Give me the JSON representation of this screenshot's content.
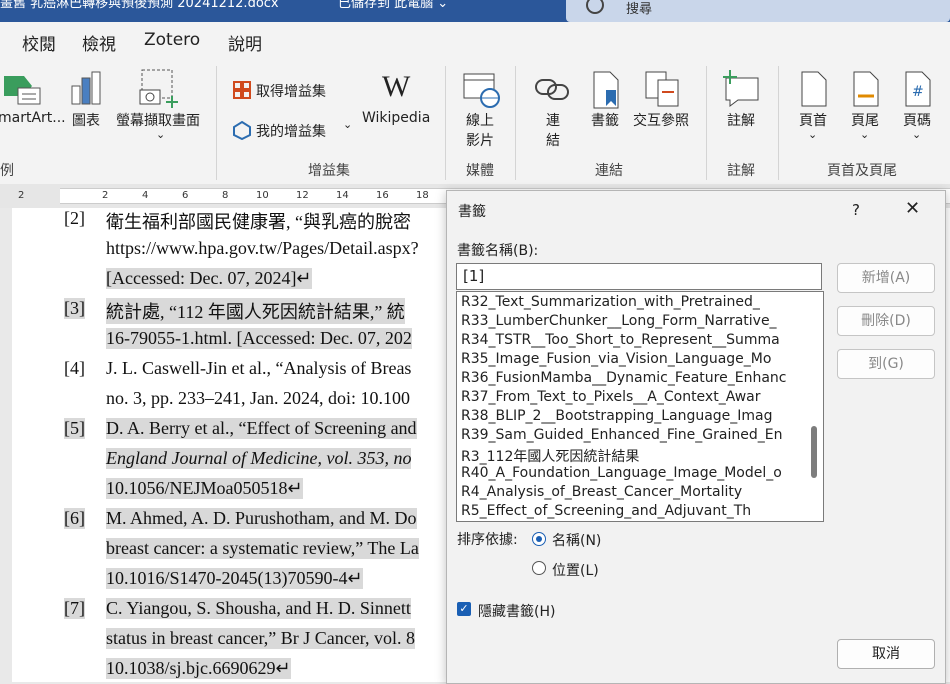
{
  "titlebar": {
    "document_name": "畫舊 乳癌淋巴轉移與預後預測 20241212.docx",
    "save_status": "已儲存到 此電腦 ⌄",
    "search_placeholder": "搜尋"
  },
  "ribbon_tabs": [
    "校閱",
    "檢視",
    "Zotero",
    "說明"
  ],
  "ribbon": {
    "smartart": "martArt...",
    "chart": "圖表",
    "screenshot": "螢幕擷取畫面",
    "get_addins": "取得增益集",
    "my_addins": "我的增益集",
    "wikipedia": "Wikipedia",
    "online_video_line1": "線上",
    "online_video_line2": "影片",
    "link_line1": "連",
    "link_line2": "結",
    "bookmark": "書籤",
    "cross_reference": "交互參照",
    "comment": "註解",
    "header": "頁首",
    "footer": "頁尾",
    "page_number": "頁碼",
    "groups": {
      "illustrations_tail": "例",
      "addins": "增益集",
      "media": "媒體",
      "links": "連結",
      "comments": "註解",
      "header_footer": "頁首及頁尾"
    }
  },
  "ruler_ticks": [
    "2",
    "2",
    "4",
    "6",
    "8",
    "10",
    "12",
    "14",
    "16",
    "18"
  ],
  "document": {
    "refs": [
      {
        "num": "[2]",
        "lines": [
          "衛生福利部國民健康署, “與乳癌的脫密",
          "https://www.hpa.gov.tw/Pages/Detail.aspx?",
          "[Accessed: Dec. 07, 2024]↵"
        ]
      },
      {
        "num": "[3]",
        "lines": [
          "統計處, “112 年國人死因統計結果,” 統",
          "16-79055-1.html. [Accessed: Dec. 07, 202"
        ]
      },
      {
        "num": "[4]",
        "lines": [
          "J. L. Caswell-Jin et al., “Analysis of Breas",
          "no. 3, pp. 233–241, Jan. 2024, doi: 10.100"
        ]
      },
      {
        "num": "[5]",
        "lines": [
          "D. A. Berry et al., “Effect of Screening and",
          "England Journal of Medicine, vol. 353, no",
          "10.1056/NEJMoa050518↵"
        ]
      },
      {
        "num": "[6]",
        "lines": [
          "M. Ahmed, A. D. Purushotham, and M. Do",
          "breast cancer: a systematic review,” The La",
          "10.1016/S1470-2045(13)70590-4↵"
        ]
      },
      {
        "num": "[7]",
        "lines": [
          "C. Yiangou, S. Shousha, and H. D. Sinnett",
          "status in breast cancer,” Br J Cancer, vol. 8",
          "10.1038/sj.bjc.6690629↵"
        ]
      }
    ]
  },
  "dialog": {
    "title": "書籤",
    "help": "?",
    "close": "✕",
    "name_label": "書籤名稱(B):",
    "name_value": "[1]",
    "bookmarks": [
      "R32_Text_Summarization_with_Pretrained_",
      "R33_LumberChunker__Long_Form_Narrative_",
      "R34_TSTR__Too_Short_to_Represent__Summa",
      "R35_Image_Fusion_via_Vision_Language_Mo",
      "R36_FusionMamba__Dynamic_Feature_Enhanc",
      "R37_From_Text_to_Pixels__A_Context_Awar",
      "R38_BLIP_2__Bootstrapping_Language_Imag",
      "R39_Sam_Guided_Enhanced_Fine_Grained_En",
      "R3_112年國人死因統計結果",
      "R40_A_Foundation_Language_Image_Model_o",
      "R4_Analysis_of_Breast_Cancer_Mortality",
      "R5_Effect_of_Screening_and_Adjuvant_Th"
    ],
    "add_button": "新增(A)",
    "delete_button": "刪除(D)",
    "goto_button": "到(G)",
    "sort_label": "排序依據:",
    "sort_name": "名稱(N)",
    "sort_location": "位置(L)",
    "sort_selected": "name",
    "hidden_label": "隱藏書籤(H)",
    "hidden_checked": true,
    "cancel_button": "取消"
  }
}
